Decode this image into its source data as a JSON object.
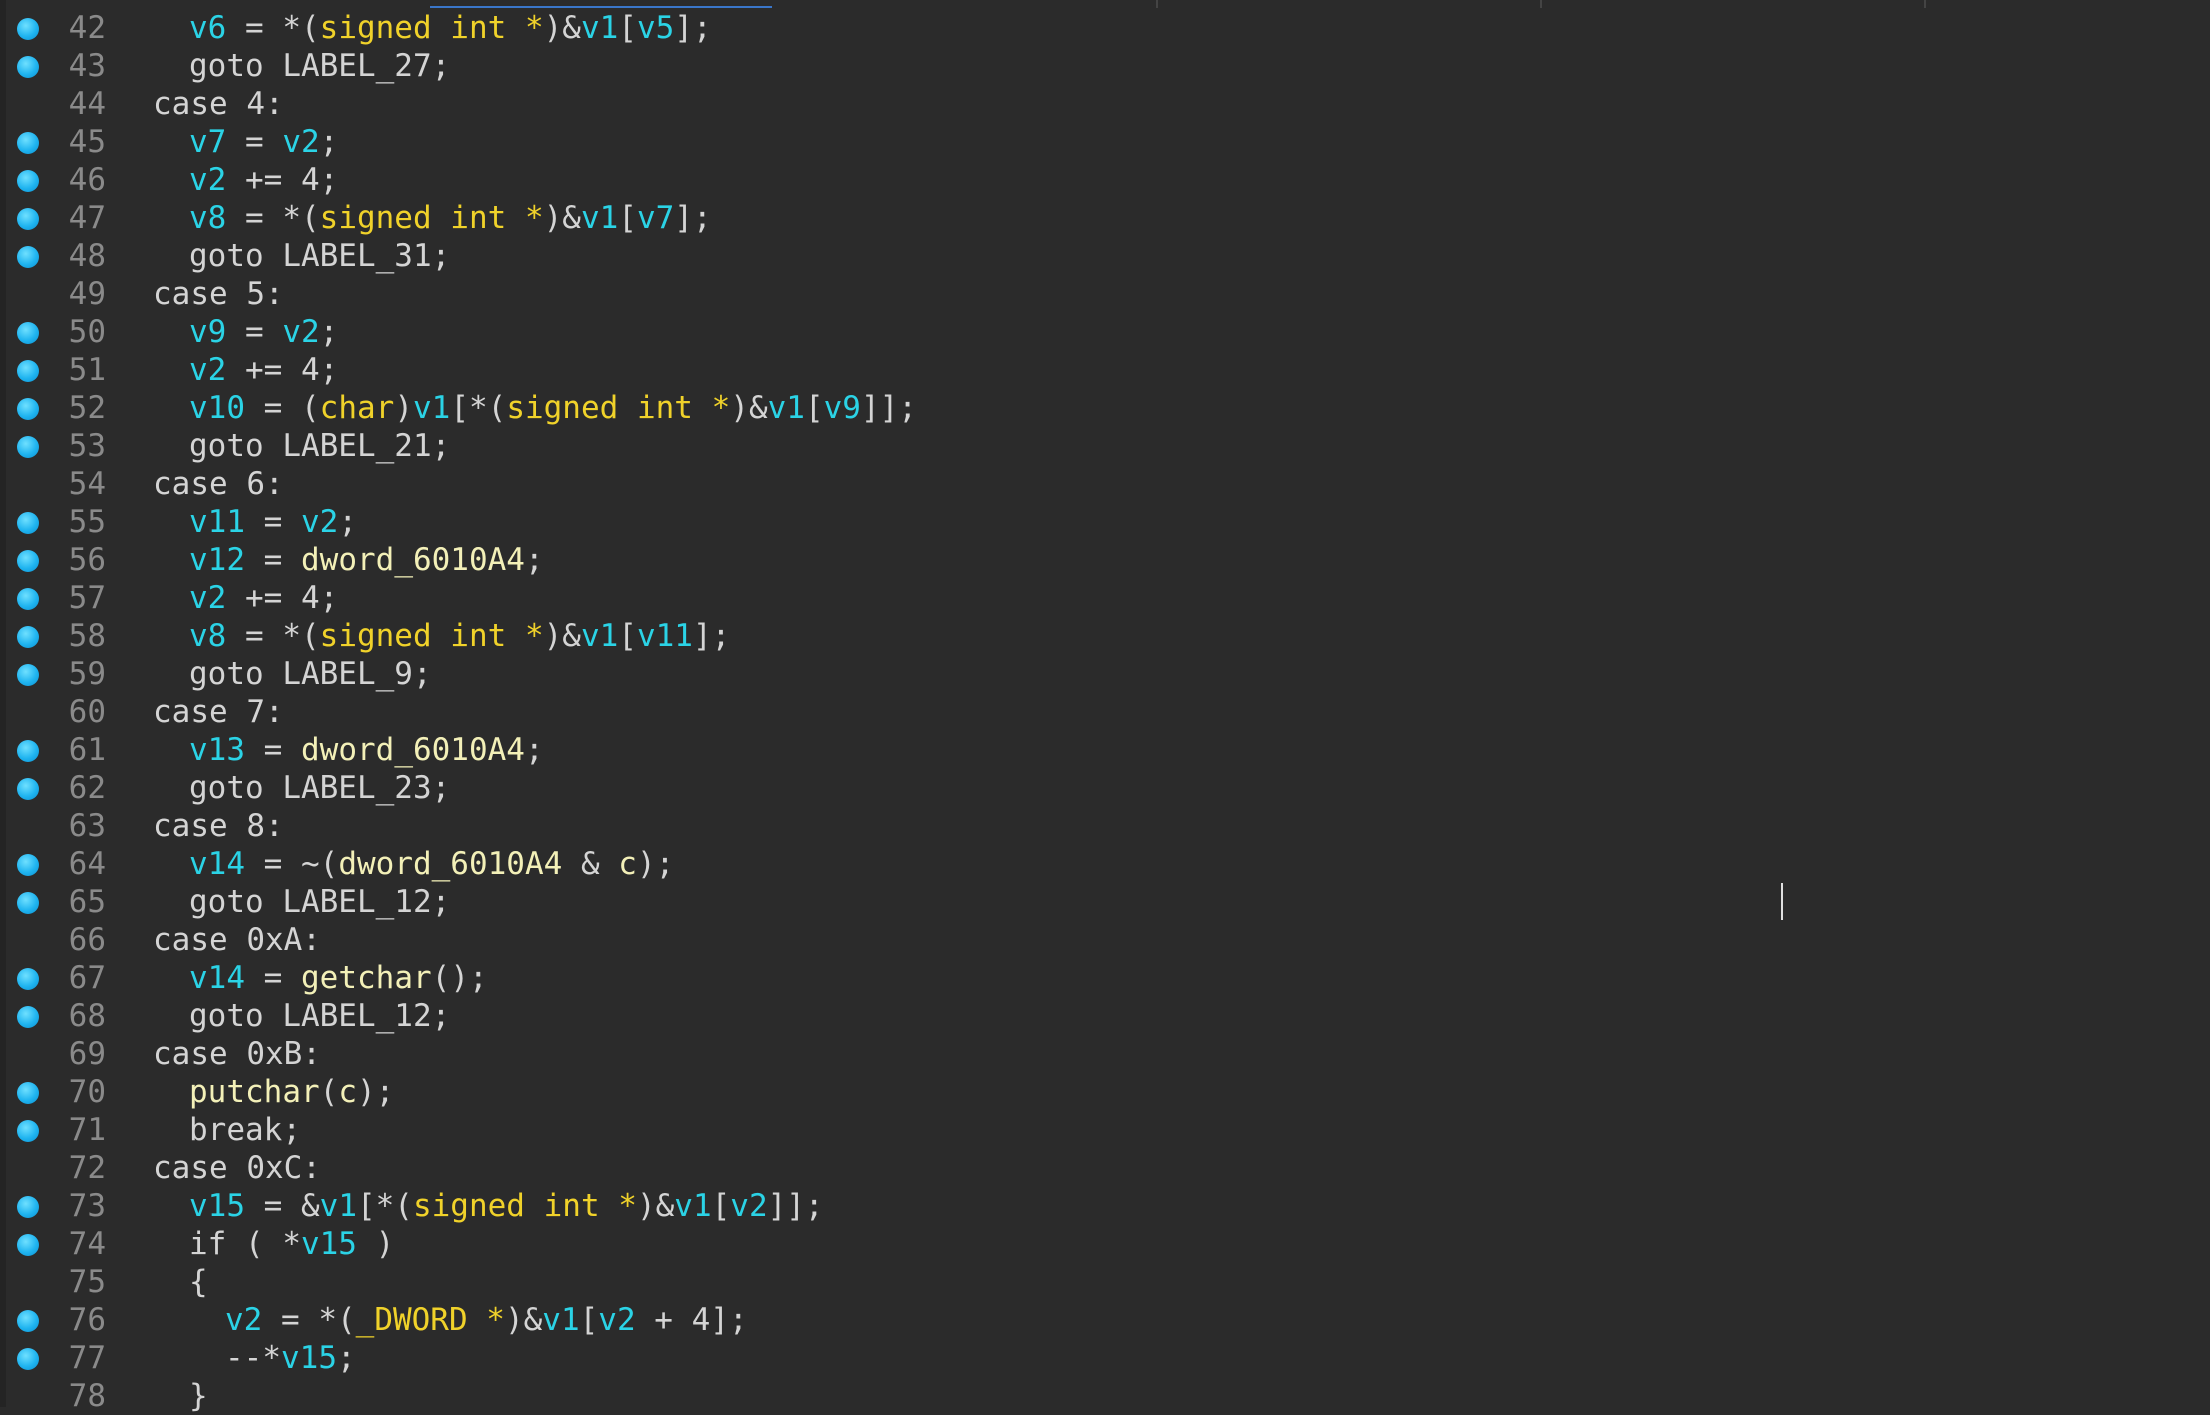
{
  "editor": {
    "lines": [
      {
        "num": "42",
        "bp": true,
        "indent": 2,
        "tokens": [
          {
            "t": "v6",
            "k": "var"
          },
          {
            "t": " = *(",
            "k": "plain"
          },
          {
            "t": "signed int *",
            "k": "type"
          },
          {
            "t": ")&",
            "k": "plain"
          },
          {
            "t": "v1",
            "k": "var"
          },
          {
            "t": "[",
            "k": "plain"
          },
          {
            "t": "v5",
            "k": "var"
          },
          {
            "t": "];",
            "k": "plain"
          }
        ]
      },
      {
        "num": "43",
        "bp": true,
        "indent": 2,
        "tokens": [
          {
            "t": "goto LABEL_27;",
            "k": "plain"
          }
        ]
      },
      {
        "num": "44",
        "bp": false,
        "indent": 1,
        "tokens": [
          {
            "t": "case 4:",
            "k": "plain"
          }
        ]
      },
      {
        "num": "45",
        "bp": true,
        "indent": 2,
        "tokens": [
          {
            "t": "v7",
            "k": "var"
          },
          {
            "t": " = ",
            "k": "plain"
          },
          {
            "t": "v2",
            "k": "var"
          },
          {
            "t": ";",
            "k": "plain"
          }
        ]
      },
      {
        "num": "46",
        "bp": true,
        "indent": 2,
        "tokens": [
          {
            "t": "v2",
            "k": "var"
          },
          {
            "t": " += 4;",
            "k": "plain"
          }
        ]
      },
      {
        "num": "47",
        "bp": true,
        "indent": 2,
        "tokens": [
          {
            "t": "v8",
            "k": "var"
          },
          {
            "t": " = *(",
            "k": "plain"
          },
          {
            "t": "signed int *",
            "k": "type"
          },
          {
            "t": ")&",
            "k": "plain"
          },
          {
            "t": "v1",
            "k": "var"
          },
          {
            "t": "[",
            "k": "plain"
          },
          {
            "t": "v7",
            "k": "var"
          },
          {
            "t": "];",
            "k": "plain"
          }
        ]
      },
      {
        "num": "48",
        "bp": true,
        "indent": 2,
        "tokens": [
          {
            "t": "goto LABEL_31;",
            "k": "plain"
          }
        ]
      },
      {
        "num": "49",
        "bp": false,
        "indent": 1,
        "tokens": [
          {
            "t": "case 5:",
            "k": "plain"
          }
        ]
      },
      {
        "num": "50",
        "bp": true,
        "indent": 2,
        "tokens": [
          {
            "t": "v9",
            "k": "var"
          },
          {
            "t": " = ",
            "k": "plain"
          },
          {
            "t": "v2",
            "k": "var"
          },
          {
            "t": ";",
            "k": "plain"
          }
        ]
      },
      {
        "num": "51",
        "bp": true,
        "indent": 2,
        "tokens": [
          {
            "t": "v2",
            "k": "var"
          },
          {
            "t": " += 4;",
            "k": "plain"
          }
        ]
      },
      {
        "num": "52",
        "bp": true,
        "indent": 2,
        "tokens": [
          {
            "t": "v10",
            "k": "var"
          },
          {
            "t": " = (",
            "k": "plain"
          },
          {
            "t": "char",
            "k": "type"
          },
          {
            "t": ")",
            "k": "plain"
          },
          {
            "t": "v1",
            "k": "var"
          },
          {
            "t": "[*(",
            "k": "plain"
          },
          {
            "t": "signed int *",
            "k": "type"
          },
          {
            "t": ")&",
            "k": "plain"
          },
          {
            "t": "v1",
            "k": "var"
          },
          {
            "t": "[",
            "k": "plain"
          },
          {
            "t": "v9",
            "k": "var"
          },
          {
            "t": "]];",
            "k": "plain"
          }
        ]
      },
      {
        "num": "53",
        "bp": true,
        "indent": 2,
        "tokens": [
          {
            "t": "goto LABEL_21;",
            "k": "plain"
          }
        ]
      },
      {
        "num": "54",
        "bp": false,
        "indent": 1,
        "tokens": [
          {
            "t": "case 6:",
            "k": "plain"
          }
        ]
      },
      {
        "num": "55",
        "bp": true,
        "indent": 2,
        "tokens": [
          {
            "t": "v11",
            "k": "var"
          },
          {
            "t": " = ",
            "k": "plain"
          },
          {
            "t": "v2",
            "k": "var"
          },
          {
            "t": ";",
            "k": "plain"
          }
        ]
      },
      {
        "num": "56",
        "bp": true,
        "indent": 2,
        "tokens": [
          {
            "t": "v12",
            "k": "var"
          },
          {
            "t": " = ",
            "k": "plain"
          },
          {
            "t": "dword_6010A4",
            "k": "gvar"
          },
          {
            "t": ";",
            "k": "plain"
          }
        ]
      },
      {
        "num": "57",
        "bp": true,
        "indent": 2,
        "tokens": [
          {
            "t": "v2",
            "k": "var"
          },
          {
            "t": " += 4;",
            "k": "plain"
          }
        ]
      },
      {
        "num": "58",
        "bp": true,
        "indent": 2,
        "tokens": [
          {
            "t": "v8",
            "k": "var"
          },
          {
            "t": " = *(",
            "k": "plain"
          },
          {
            "t": "signed int *",
            "k": "type"
          },
          {
            "t": ")&",
            "k": "plain"
          },
          {
            "t": "v1",
            "k": "var"
          },
          {
            "t": "[",
            "k": "plain"
          },
          {
            "t": "v11",
            "k": "var"
          },
          {
            "t": "];",
            "k": "plain"
          }
        ]
      },
      {
        "num": "59",
        "bp": true,
        "indent": 2,
        "tokens": [
          {
            "t": "goto LABEL_9;",
            "k": "plain"
          }
        ]
      },
      {
        "num": "60",
        "bp": false,
        "indent": 1,
        "tokens": [
          {
            "t": "case 7:",
            "k": "plain"
          }
        ]
      },
      {
        "num": "61",
        "bp": true,
        "indent": 2,
        "tokens": [
          {
            "t": "v13",
            "k": "var"
          },
          {
            "t": " = ",
            "k": "plain"
          },
          {
            "t": "dword_6010A4",
            "k": "gvar"
          },
          {
            "t": ";",
            "k": "plain"
          }
        ]
      },
      {
        "num": "62",
        "bp": true,
        "indent": 2,
        "tokens": [
          {
            "t": "goto LABEL_23;",
            "k": "plain"
          }
        ]
      },
      {
        "num": "63",
        "bp": false,
        "indent": 1,
        "tokens": [
          {
            "t": "case 8:",
            "k": "plain"
          }
        ]
      },
      {
        "num": "64",
        "bp": true,
        "indent": 2,
        "tokens": [
          {
            "t": "v14",
            "k": "var"
          },
          {
            "t": " = ~(",
            "k": "plain"
          },
          {
            "t": "dword_6010A4",
            "k": "gvar"
          },
          {
            "t": " & ",
            "k": "plain"
          },
          {
            "t": "c",
            "k": "gvar"
          },
          {
            "t": ");",
            "k": "plain"
          }
        ]
      },
      {
        "num": "65",
        "bp": true,
        "indent": 2,
        "tokens": [
          {
            "t": "goto LABEL_12;",
            "k": "plain"
          }
        ]
      },
      {
        "num": "66",
        "bp": false,
        "indent": 1,
        "tokens": [
          {
            "t": "case 0xA:",
            "k": "plain"
          }
        ]
      },
      {
        "num": "67",
        "bp": true,
        "indent": 2,
        "tokens": [
          {
            "t": "v14",
            "k": "var"
          },
          {
            "t": " = ",
            "k": "plain"
          },
          {
            "t": "getchar",
            "k": "func"
          },
          {
            "t": "();",
            "k": "plain"
          }
        ]
      },
      {
        "num": "68",
        "bp": true,
        "indent": 2,
        "tokens": [
          {
            "t": "goto LABEL_12;",
            "k": "plain"
          }
        ]
      },
      {
        "num": "69",
        "bp": false,
        "indent": 1,
        "tokens": [
          {
            "t": "case 0xB:",
            "k": "plain"
          }
        ]
      },
      {
        "num": "70",
        "bp": true,
        "indent": 2,
        "tokens": [
          {
            "t": "putchar",
            "k": "func"
          },
          {
            "t": "(",
            "k": "plain"
          },
          {
            "t": "c",
            "k": "gvar"
          },
          {
            "t": ");",
            "k": "plain"
          }
        ]
      },
      {
        "num": "71",
        "bp": true,
        "indent": 2,
        "tokens": [
          {
            "t": "break;",
            "k": "plain"
          }
        ]
      },
      {
        "num": "72",
        "bp": false,
        "indent": 1,
        "tokens": [
          {
            "t": "case 0xC:",
            "k": "plain"
          }
        ]
      },
      {
        "num": "73",
        "bp": true,
        "indent": 2,
        "tokens": [
          {
            "t": "v15",
            "k": "var"
          },
          {
            "t": " = &",
            "k": "plain"
          },
          {
            "t": "v1",
            "k": "var"
          },
          {
            "t": "[*(",
            "k": "plain"
          },
          {
            "t": "signed int *",
            "k": "type"
          },
          {
            "t": ")&",
            "k": "plain"
          },
          {
            "t": "v1",
            "k": "var"
          },
          {
            "t": "[",
            "k": "plain"
          },
          {
            "t": "v2",
            "k": "var"
          },
          {
            "t": "]];",
            "k": "plain"
          }
        ]
      },
      {
        "num": "74",
        "bp": true,
        "indent": 2,
        "tokens": [
          {
            "t": "if ( *",
            "k": "plain"
          },
          {
            "t": "v15",
            "k": "var"
          },
          {
            "t": " )",
            "k": "plain"
          }
        ]
      },
      {
        "num": "75",
        "bp": false,
        "indent": 2,
        "tokens": [
          {
            "t": "{",
            "k": "plain"
          }
        ]
      },
      {
        "num": "76",
        "bp": true,
        "indent": 3,
        "tokens": [
          {
            "t": "v2",
            "k": "var"
          },
          {
            "t": " = *(",
            "k": "plain"
          },
          {
            "t": "_DWORD *",
            "k": "type"
          },
          {
            "t": ")&",
            "k": "plain"
          },
          {
            "t": "v1",
            "k": "var"
          },
          {
            "t": "[",
            "k": "plain"
          },
          {
            "t": "v2",
            "k": "var"
          },
          {
            "t": " + 4];",
            "k": "plain"
          }
        ]
      },
      {
        "num": "77",
        "bp": true,
        "indent": 3,
        "tokens": [
          {
            "t": "--*",
            "k": "plain"
          },
          {
            "t": "v15",
            "k": "var"
          },
          {
            "t": ";",
            "k": "plain"
          }
        ]
      },
      {
        "num": "78",
        "bp": false,
        "indent": 2,
        "tokens": [
          {
            "t": "}",
            "k": "plain"
          }
        ]
      }
    ]
  },
  "colors": {
    "background": "#2b2b2b",
    "variable": "#2bd3e6",
    "type": "#f0d22a",
    "global": "#f3f0b8",
    "plain": "#d4d4d4",
    "line_number": "#8a8a8a",
    "breakpoint": "#1fb4f0"
  }
}
